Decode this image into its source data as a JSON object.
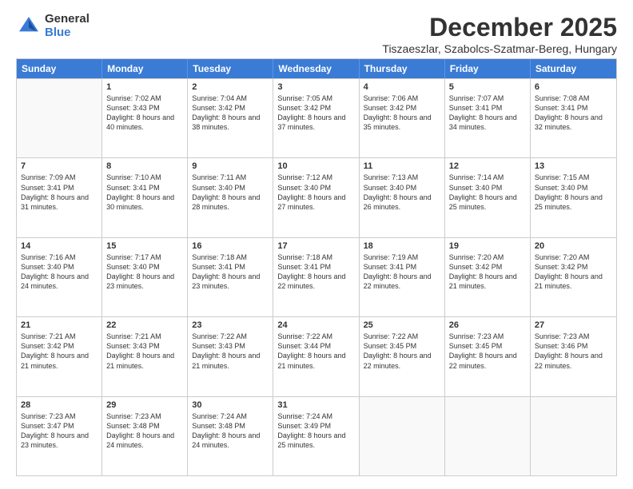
{
  "logo": {
    "general": "General",
    "blue": "Blue"
  },
  "title": "December 2025",
  "location": "Tiszaeszlar, Szabolcs-Szatmar-Bereg, Hungary",
  "days": [
    "Sunday",
    "Monday",
    "Tuesday",
    "Wednesday",
    "Thursday",
    "Friday",
    "Saturday"
  ],
  "weeks": [
    [
      {
        "day": null,
        "info": null
      },
      {
        "day": "1",
        "sunrise": "7:02 AM",
        "sunset": "3:43 PM",
        "daylight": "8 hours and 40 minutes."
      },
      {
        "day": "2",
        "sunrise": "7:04 AM",
        "sunset": "3:42 PM",
        "daylight": "8 hours and 38 minutes."
      },
      {
        "day": "3",
        "sunrise": "7:05 AM",
        "sunset": "3:42 PM",
        "daylight": "8 hours and 37 minutes."
      },
      {
        "day": "4",
        "sunrise": "7:06 AM",
        "sunset": "3:42 PM",
        "daylight": "8 hours and 35 minutes."
      },
      {
        "day": "5",
        "sunrise": "7:07 AM",
        "sunset": "3:41 PM",
        "daylight": "8 hours and 34 minutes."
      },
      {
        "day": "6",
        "sunrise": "7:08 AM",
        "sunset": "3:41 PM",
        "daylight": "8 hours and 32 minutes."
      }
    ],
    [
      {
        "day": "7",
        "sunrise": "7:09 AM",
        "sunset": "3:41 PM",
        "daylight": "8 hours and 31 minutes."
      },
      {
        "day": "8",
        "sunrise": "7:10 AM",
        "sunset": "3:41 PM",
        "daylight": "8 hours and 30 minutes."
      },
      {
        "day": "9",
        "sunrise": "7:11 AM",
        "sunset": "3:40 PM",
        "daylight": "8 hours and 28 minutes."
      },
      {
        "day": "10",
        "sunrise": "7:12 AM",
        "sunset": "3:40 PM",
        "daylight": "8 hours and 27 minutes."
      },
      {
        "day": "11",
        "sunrise": "7:13 AM",
        "sunset": "3:40 PM",
        "daylight": "8 hours and 26 minutes."
      },
      {
        "day": "12",
        "sunrise": "7:14 AM",
        "sunset": "3:40 PM",
        "daylight": "8 hours and 25 minutes."
      },
      {
        "day": "13",
        "sunrise": "7:15 AM",
        "sunset": "3:40 PM",
        "daylight": "8 hours and 25 minutes."
      }
    ],
    [
      {
        "day": "14",
        "sunrise": "7:16 AM",
        "sunset": "3:40 PM",
        "daylight": "8 hours and 24 minutes."
      },
      {
        "day": "15",
        "sunrise": "7:17 AM",
        "sunset": "3:40 PM",
        "daylight": "8 hours and 23 minutes."
      },
      {
        "day": "16",
        "sunrise": "7:18 AM",
        "sunset": "3:41 PM",
        "daylight": "8 hours and 23 minutes."
      },
      {
        "day": "17",
        "sunrise": "7:18 AM",
        "sunset": "3:41 PM",
        "daylight": "8 hours and 22 minutes."
      },
      {
        "day": "18",
        "sunrise": "7:19 AM",
        "sunset": "3:41 PM",
        "daylight": "8 hours and 22 minutes."
      },
      {
        "day": "19",
        "sunrise": "7:20 AM",
        "sunset": "3:42 PM",
        "daylight": "8 hours and 21 minutes."
      },
      {
        "day": "20",
        "sunrise": "7:20 AM",
        "sunset": "3:42 PM",
        "daylight": "8 hours and 21 minutes."
      }
    ],
    [
      {
        "day": "21",
        "sunrise": "7:21 AM",
        "sunset": "3:42 PM",
        "daylight": "8 hours and 21 minutes."
      },
      {
        "day": "22",
        "sunrise": "7:21 AM",
        "sunset": "3:43 PM",
        "daylight": "8 hours and 21 minutes."
      },
      {
        "day": "23",
        "sunrise": "7:22 AM",
        "sunset": "3:43 PM",
        "daylight": "8 hours and 21 minutes."
      },
      {
        "day": "24",
        "sunrise": "7:22 AM",
        "sunset": "3:44 PM",
        "daylight": "8 hours and 21 minutes."
      },
      {
        "day": "25",
        "sunrise": "7:22 AM",
        "sunset": "3:45 PM",
        "daylight": "8 hours and 22 minutes."
      },
      {
        "day": "26",
        "sunrise": "7:23 AM",
        "sunset": "3:45 PM",
        "daylight": "8 hours and 22 minutes."
      },
      {
        "day": "27",
        "sunrise": "7:23 AM",
        "sunset": "3:46 PM",
        "daylight": "8 hours and 22 minutes."
      }
    ],
    [
      {
        "day": "28",
        "sunrise": "7:23 AM",
        "sunset": "3:47 PM",
        "daylight": "8 hours and 23 minutes."
      },
      {
        "day": "29",
        "sunrise": "7:23 AM",
        "sunset": "3:48 PM",
        "daylight": "8 hours and 24 minutes."
      },
      {
        "day": "30",
        "sunrise": "7:24 AM",
        "sunset": "3:48 PM",
        "daylight": "8 hours and 24 minutes."
      },
      {
        "day": "31",
        "sunrise": "7:24 AM",
        "sunset": "3:49 PM",
        "daylight": "8 hours and 25 minutes."
      },
      {
        "day": null,
        "info": null
      },
      {
        "day": null,
        "info": null
      },
      {
        "day": null,
        "info": null
      }
    ]
  ]
}
